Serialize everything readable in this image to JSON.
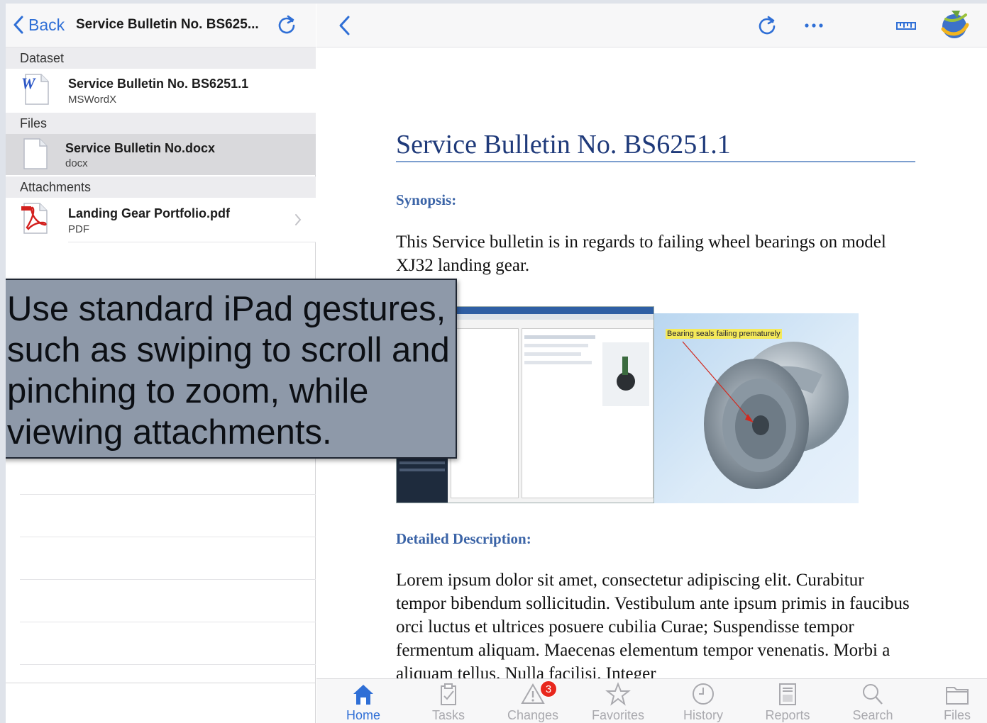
{
  "left_panel": {
    "back_label": "Back",
    "title": "Service Bulletin No. BS625...",
    "sections": [
      {
        "header": "Dataset",
        "items": [
          {
            "title": "Service Bulletin No. BS6251.1",
            "subtitle": "MSWordX",
            "icon": "word-document-icon"
          }
        ]
      },
      {
        "header": "Files",
        "items": [
          {
            "title": "Service Bulletin No.docx",
            "subtitle": "docx",
            "icon": "blank-document-icon",
            "selected": true
          }
        ]
      },
      {
        "header": "Attachments",
        "items": [
          {
            "title": "Landing Gear Portfolio.pdf",
            "subtitle": "PDF",
            "icon": "pdf-document-icon",
            "has_chevron": true
          }
        ]
      }
    ]
  },
  "right_panel": {
    "toolbar_icons": [
      "back-chevron-icon",
      "refresh-icon",
      "more-icon",
      "ruler-icon",
      "app-logo-icon"
    ],
    "document": {
      "title": "Service Bulletin No. BS6251.1",
      "synopsis_heading": "Synopsis:",
      "synopsis_text": "This Service bulletin is in regards to failing wheel bearings on model XJ32 landing gear.",
      "figure_caption": "Bearing seals failing prematurely",
      "detailed_heading": "Detailed Description:",
      "detailed_text": "Lorem ipsum dolor sit amet, consectetur adipiscing elit. Curabitur tempor bibendum sollicitudin. Vestibulum ante ipsum primis in faucibus orci luctus et ultrices posuere cubilia Curae; Suspendisse tempor fermentum aliquam. Maecenas elementum tempor venenatis. Morbi a aliquam tellus. Nulla facilisi. Integer"
    },
    "tabbar": {
      "tabs": [
        {
          "label": "Home",
          "icon": "home-icon",
          "active": true
        },
        {
          "label": "Tasks",
          "icon": "tasks-icon"
        },
        {
          "label": "Changes",
          "icon": "changes-icon",
          "badge": "3"
        },
        {
          "label": "Favorites",
          "icon": "star-icon"
        },
        {
          "label": "History",
          "icon": "clock-icon"
        },
        {
          "label": "Reports",
          "icon": "reports-icon"
        },
        {
          "label": "Search",
          "icon": "search-icon"
        },
        {
          "label": "Files",
          "icon": "folder-icon"
        }
      ]
    }
  },
  "callout": {
    "text": "Use standard iPad gestures, such as swiping to scroll and pinching to zoom, while viewing attachments."
  },
  "colors": {
    "accent": "#2f6fd6",
    "doc_heading": "#3b64a7",
    "doc_title": "#1f3a7a",
    "callout_bg": "#8e99a9",
    "badge": "#e8271d"
  }
}
